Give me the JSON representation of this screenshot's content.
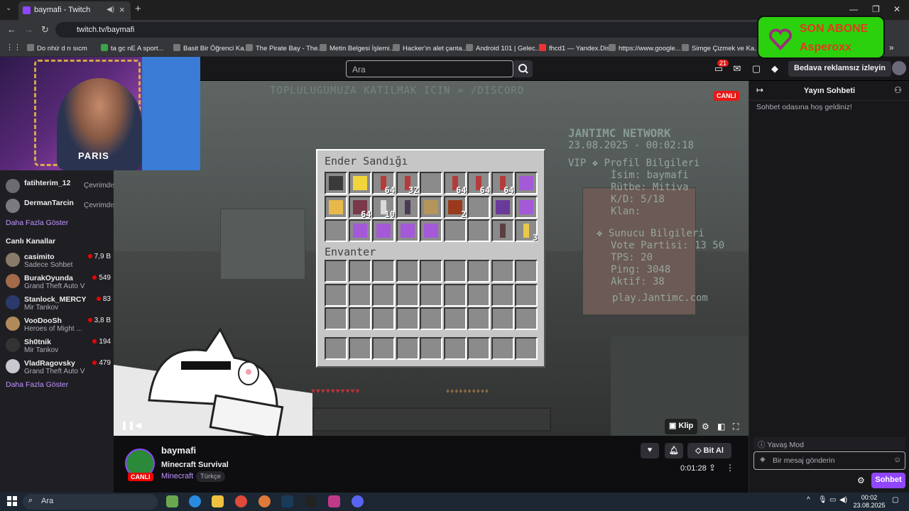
{
  "browser": {
    "tab_title": "baymafi - Twitch",
    "url": "twitch.tv/baymafi",
    "bookmarks": [
      "Do nhứ d rı sıcm",
      "ta gc nE A sport...",
      "Basit Bir Öğrenci Ka...",
      "The Pirate Bay - The...",
      "Metin Belgesi İşlemi...",
      "Hacker'ın alet çanta...",
      "Android 101 | Gelec...",
      "fhcd1 — Yandex.Disk",
      "https://www.google...",
      "Simge Çizmek ve Ka..."
    ]
  },
  "twitch_nav": {
    "search_placeholder": "Ara",
    "notif_count": "21",
    "adfree_label": "Bedava reklamsız izleyin"
  },
  "sub_overlay": {
    "line1": "SON ABONE",
    "line2": "Asperoxx"
  },
  "sidebar": {
    "followed": [
      {
        "name": "fatihterim_12",
        "status": "Çevrimdışı"
      },
      {
        "name": "DermanTarcin",
        "status": "Çevrimdışı"
      }
    ],
    "show_more_1": "Daha Fazla Göster",
    "live_header": "Canlı Kanallar",
    "live": [
      {
        "name": "casimito",
        "game": "Sadece Sohbet",
        "viewers": "7,9 B"
      },
      {
        "name": "BurakOyunda",
        "game": "Grand Theft Auto V",
        "viewers": "549"
      },
      {
        "name": "Stanlock_MERCY",
        "game": "Mir Tankov",
        "viewers": "83"
      },
      {
        "name": "VooDooSh",
        "game": "Heroes of Might ...",
        "viewers": "3,8 B"
      },
      {
        "name": "Sh0tnik",
        "game": "Mir Tankov",
        "viewers": "194"
      },
      {
        "name": "VladRagovsky",
        "game": "Grand Theft Auto V",
        "viewers": "479"
      }
    ],
    "show_more_2": "Daha Fazla Göster"
  },
  "game": {
    "top_banner": "TOPLULUGUMUZA KATILMAK ICIN » /DISCORD",
    "live_badge": "CANLI",
    "scoreboard": {
      "title": "JANTIMC NETWORK",
      "date_line": "23.08.2025 - 00:02:18",
      "lines": [
        "VIP ❖ Profil Bilgileri",
        "İsim: baymafi",
        "Rütbe: Mitiva",
        "K/D: 5/18",
        "Klan:",
        "❖ Sunucu Bilgileri",
        "Vote Partisi: 13 50",
        "TPS: 20",
        "Ping: 3048",
        "Aktif: 38",
        "play.Jantimc.com"
      ]
    },
    "chest_title": "Ender Sandığı",
    "inventory_title": "Envanter",
    "chest_slots": [
      {
        "item": "netherite-block",
        "color": "#3a3a3c",
        "count": ""
      },
      {
        "item": "gold-block",
        "color": "#f2d53a",
        "count": ""
      },
      {
        "item": "firework-rocket",
        "color": "#b53b3b",
        "count": "64"
      },
      {
        "item": "firework-rocket",
        "color": "#b53b3b",
        "count": "32"
      },
      {
        "item": "",
        "color": "",
        "count": ""
      },
      {
        "item": "firework-rocket",
        "color": "#b53b3b",
        "count": "64"
      },
      {
        "item": "firework-rocket",
        "color": "#b53b3b",
        "count": "64"
      },
      {
        "item": "firework-rocket",
        "color": "#b53b3b",
        "count": "64"
      },
      {
        "item": "enchanted-leggings",
        "color": "#a45ad8",
        "count": ""
      },
      {
        "item": "totem",
        "color": "#e8b94a",
        "count": ""
      },
      {
        "item": "shulker",
        "color": "#7a3848",
        "count": "64"
      },
      {
        "item": "string",
        "color": "#d9d9d9",
        "count": "10"
      },
      {
        "item": "netherite-pickaxe",
        "color": "#4b3a55",
        "count": ""
      },
      {
        "item": "wood-planks",
        "color": "#b5955a",
        "count": ""
      },
      {
        "item": "magma-block",
        "color": "#9a3a1c",
        "count": "2"
      },
      {
        "item": "",
        "color": "",
        "count": ""
      },
      {
        "item": "enchanted-helmet",
        "color": "#6a3a9a",
        "count": ""
      },
      {
        "item": "enchanted-leggings",
        "color": "#a45ad8",
        "count": ""
      },
      {
        "item": "",
        "color": "",
        "count": ""
      },
      {
        "item": "enchanted-boots",
        "color": "#a45ad8",
        "count": ""
      },
      {
        "item": "enchanted-leggings",
        "color": "#a45ad8",
        "count": ""
      },
      {
        "item": "enchanted-chestplate",
        "color": "#a45ad8",
        "count": ""
      },
      {
        "item": "enchanted-chestplate",
        "color": "#a45ad8",
        "count": ""
      },
      {
        "item": "",
        "color": "",
        "count": ""
      },
      {
        "item": "",
        "color": "",
        "count": ""
      },
      {
        "item": "netherite-sword",
        "color": "#5a4040",
        "count": ""
      },
      {
        "item": "gold-nugget",
        "color": "#e8c84a",
        "count": "3"
      }
    ]
  },
  "player": {
    "clip_label": "Klip"
  },
  "stream_info": {
    "live_badge": "CANLI",
    "channel_name": "baymafi",
    "title": "Minecraft Survival",
    "game": "Minecraft",
    "tag": "Türkçe",
    "bits_label": "Bit Al",
    "uptime": "0:01:28"
  },
  "chat": {
    "title": "Yayın Sohbeti",
    "welcome": "Sohbet odasına hoş geldiniz!",
    "slow_mode": "Yavaş Mod",
    "input_placeholder": "Bir mesaj gönderin",
    "send_label": "Sohbet"
  },
  "taskbar": {
    "search_label": "Ara",
    "time": "00:02",
    "date": "23.08.2025"
  }
}
